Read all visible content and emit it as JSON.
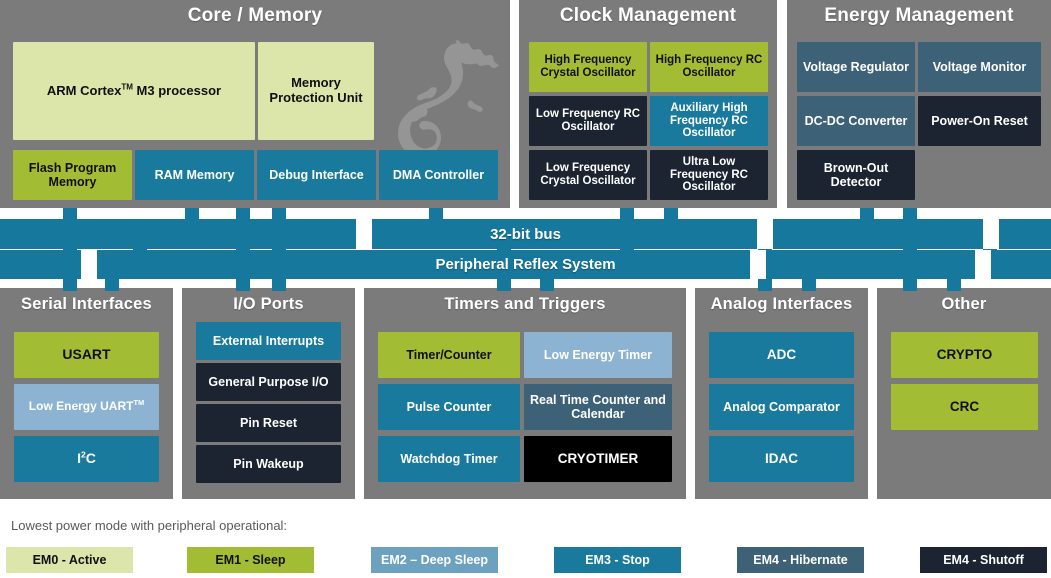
{
  "panels": {
    "core_memory": {
      "title": "Core / Memory",
      "blocks": [
        {
          "label": "ARM Cortex™ M3 processor",
          "mode": "EM0 - Active"
        },
        {
          "label": "Memory Protection Unit",
          "mode": "EM0 - Active"
        },
        {
          "label": "Flash Program Memory",
          "mode": "EM1 - Sleep"
        },
        {
          "label": "RAM Memory",
          "mode": "EM3 - Stop"
        },
        {
          "label": "Debug Interface",
          "mode": "EM3 - Stop"
        },
        {
          "label": "DMA Controller",
          "mode": "EM3 - Stop"
        }
      ]
    },
    "clock_management": {
      "title": "Clock Management",
      "blocks": [
        {
          "label": "High Frequency Crystal Oscillator",
          "mode": "EM1 - Sleep"
        },
        {
          "label": "High Frequency RC Oscillator",
          "mode": "EM1 - Sleep"
        },
        {
          "label": "Low Frequency RC Oscillator",
          "mode": "EM4 - Shutoff"
        },
        {
          "label": "Auxiliary High Frequency RC Oscillator",
          "mode": "EM3 - Stop"
        },
        {
          "label": "Low Frequency Crystal Oscillator",
          "mode": "EM4 - Shutoff"
        },
        {
          "label": "Ultra Low Frequency RC Oscillator",
          "mode": "EM4 - Shutoff"
        }
      ]
    },
    "energy_management": {
      "title": "Energy Management",
      "blocks": [
        {
          "label": "Voltage Regulator",
          "mode": "EM4 - Hibernate"
        },
        {
          "label": "Voltage Monitor",
          "mode": "EM4 - Hibernate"
        },
        {
          "label": "DC-DC Converter",
          "mode": "EM4 - Hibernate"
        },
        {
          "label": "Power-On Reset",
          "mode": "EM4 - Shutoff"
        },
        {
          "label": "Brown-Out Detector",
          "mode": "EM4 - Shutoff"
        }
      ]
    },
    "serial_interfaces": {
      "title": "Serial Interfaces",
      "blocks": [
        {
          "label": "USART",
          "mode": "EM1 - Sleep"
        },
        {
          "label": "Low Energy UART™",
          "mode": "EM2 – Deep Sleep"
        },
        {
          "label": "I²C",
          "mode": "EM3 - Stop"
        }
      ]
    },
    "io_ports": {
      "title": "I/O Ports",
      "blocks": [
        {
          "label": "External Interrupts",
          "mode": "EM3 - Stop"
        },
        {
          "label": "General Purpose I/O",
          "mode": "EM4 - Shutoff"
        },
        {
          "label": "Pin Reset",
          "mode": "EM4 - Shutoff"
        },
        {
          "label": "Pin Wakeup",
          "mode": "EM4 - Shutoff"
        }
      ]
    },
    "timers_triggers": {
      "title": "Timers and Triggers",
      "blocks": [
        {
          "label": "Timer/Counter",
          "mode": "EM1 - Sleep"
        },
        {
          "label": "Low Energy Timer",
          "mode": "EM2 – Deep Sleep"
        },
        {
          "label": "Pulse Counter",
          "mode": "EM3 - Stop"
        },
        {
          "label": "Real Time Counter and Calendar",
          "mode": "EM4 - Hibernate"
        },
        {
          "label": "Watchdog Timer",
          "mode": "EM3 - Stop"
        },
        {
          "label": "CRYOTIMER",
          "mode": "EM4 - Shutoff"
        }
      ]
    },
    "analog_interfaces": {
      "title": "Analog Interfaces",
      "blocks": [
        {
          "label": "ADC",
          "mode": "EM3 - Stop"
        },
        {
          "label": "Analog Comparator",
          "mode": "EM3 - Stop"
        },
        {
          "label": "IDAC",
          "mode": "EM3 - Stop"
        }
      ]
    },
    "other": {
      "title": "Other",
      "blocks": [
        {
          "label": "CRYPTO",
          "mode": "EM1 - Sleep"
        },
        {
          "label": "CRC",
          "mode": "EM1 - Sleep"
        }
      ]
    }
  },
  "buses": {
    "bus32": "32-bit bus",
    "prs": "Peripheral Reflex System"
  },
  "legend": {
    "caption": "Lowest power mode with peripheral operational:",
    "items": [
      {
        "label": "EM0 - Active",
        "color": "#dce6aa",
        "text_color": "#101010"
      },
      {
        "label": "EM1 - Sleep",
        "color": "#a2bd34",
        "text_color": "#101010"
      },
      {
        "label": "EM2 – Deep Sleep",
        "color": "#8cb4d2",
        "text_color": "#ffffff"
      },
      {
        "label": "EM3 - Stop",
        "color": "#1a7a9e",
        "text_color": "#ffffff"
      },
      {
        "label": "EM4 - Hibernate",
        "color": "#3d6177",
        "text_color": "#ffffff"
      },
      {
        "label": "EM4 - Shutoff",
        "color": "#1b2430",
        "text_color": "#ffffff"
      }
    ]
  },
  "logo": {
    "name": "gecko-silhouette",
    "color": "#b2b2b2"
  },
  "colors": {
    "panel_bg": "#7b7b7b",
    "bus": "#16789c",
    "page_bg": "#ffffff"
  }
}
